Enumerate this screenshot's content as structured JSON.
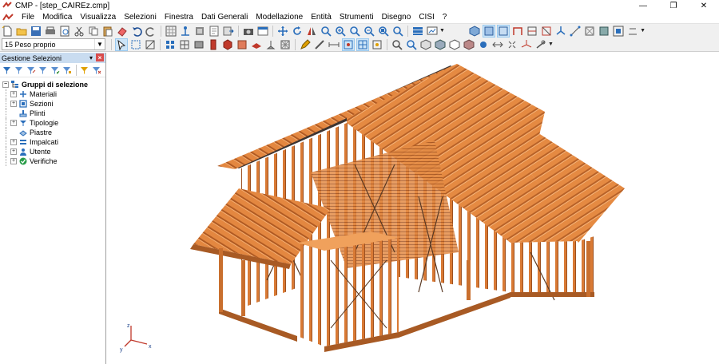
{
  "window": {
    "title": "CMP - [step_CAIREz.cmp]",
    "app_logo": "cmp-logo",
    "controls": [
      "minimize-icon",
      "restore-icon",
      "close-icon"
    ]
  },
  "menu": {
    "items": [
      "File",
      "Modifica",
      "Visualizza",
      "Selezioni",
      "Finestra",
      "Dati Generali",
      "Modellazione",
      "Entità",
      "Strumenti",
      "Disegno",
      "CISI",
      "?"
    ]
  },
  "toolbar2": {
    "load_case": "15 Peso proprio"
  },
  "panel": {
    "title": "Gestione Selezioni",
    "tree_root": "Gruppi di selezione",
    "tree_items": [
      {
        "label": "Materiali",
        "expandable": true,
        "icon": "materials-icon"
      },
      {
        "label": "Sezioni",
        "expandable": true,
        "icon": "sections-icon"
      },
      {
        "label": "Plinti",
        "expandable": false,
        "icon": "plinth-icon"
      },
      {
        "label": "Tipologie",
        "expandable": true,
        "icon": "typology-icon"
      },
      {
        "label": "Piastre",
        "expandable": false,
        "icon": "plate-icon"
      },
      {
        "label": "Impalcati",
        "expandable": true,
        "icon": "floor-icon"
      },
      {
        "label": "Utente",
        "expandable": true,
        "icon": "user-icon"
      },
      {
        "label": "Verifiche",
        "expandable": true,
        "icon": "check-icon"
      }
    ]
  },
  "viewport": {
    "content": "3d-timber-frame-house-model",
    "axis_labels": [
      "z",
      "y",
      "x"
    ]
  },
  "colors": {
    "wood": "#e0843c",
    "wood_dark": "#a85a24",
    "wood_light": "#f4ab6c",
    "panel_header": "#c9dcf0"
  }
}
